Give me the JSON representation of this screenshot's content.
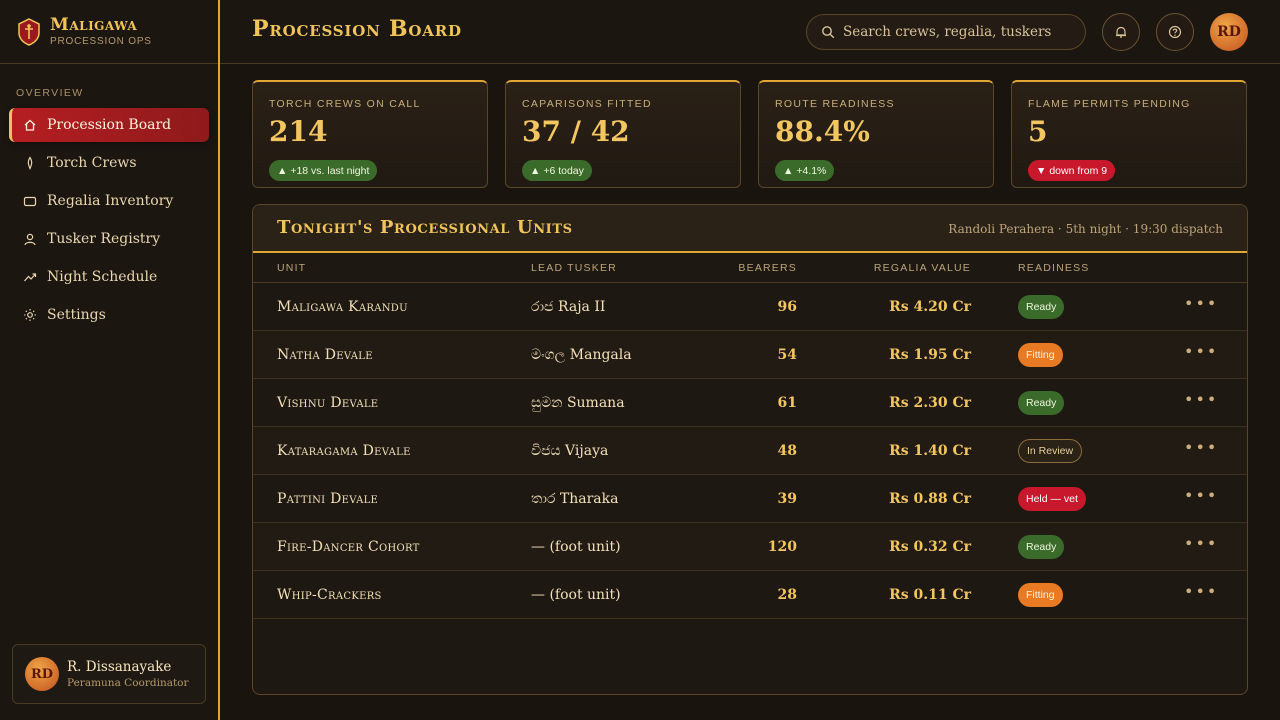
{
  "brand": {
    "name": "Maligawa",
    "subtitle": "PROCESSION OPS"
  },
  "sidebar": {
    "section": "OVERVIEW",
    "items": [
      {
        "label": "Procession Board",
        "icon": "home-icon",
        "active": true
      },
      {
        "label": "Torch Crews",
        "icon": "flame-icon"
      },
      {
        "label": "Regalia Inventory",
        "icon": "box-icon"
      },
      {
        "label": "Tusker Registry",
        "icon": "user-icon"
      },
      {
        "label": "Night Schedule",
        "icon": "trend-icon"
      },
      {
        "label": "Settings",
        "icon": "sun-gear-icon"
      }
    ],
    "user": {
      "initials": "RD",
      "name": "R. Dissanayake",
      "role": "Peramuna Coordinator"
    }
  },
  "header": {
    "title": "Procession Board",
    "search_placeholder": "Search crews, regalia, tuskers",
    "avatar_initials": "RD"
  },
  "stats": [
    {
      "label": "TORCH CREWS ON CALL",
      "value": "214",
      "delta": "+18 vs. last night",
      "trend": "up"
    },
    {
      "label": "CAPARISONS FITTED",
      "value": "37 / 42",
      "delta": "+6 today",
      "trend": "up"
    },
    {
      "label": "ROUTE READINESS",
      "value": "88.4%",
      "delta": "+4.1%",
      "trend": "up"
    },
    {
      "label": "FLAME PERMITS PENDING",
      "value": "5",
      "delta": "down from 9",
      "trend": "down"
    }
  ],
  "table": {
    "title": "Tonight's Processional Units",
    "meta": "Randoli Perahera · 5th night · 19:30 dispatch",
    "columns": [
      "UNIT",
      "LEAD TUSKER",
      "BEARERS",
      "REGALIA VALUE",
      "READINESS"
    ],
    "rows": [
      {
        "unit": "Maligawa Karandu",
        "tusker": "රාජ Raja II",
        "bearers": "96",
        "value": "Rs 4.20 Cr",
        "status": "Ready",
        "kind": "ready"
      },
      {
        "unit": "Natha Devale",
        "tusker": "මංගල Mangala",
        "bearers": "54",
        "value": "Rs 1.95 Cr",
        "status": "Fitting",
        "kind": "fitting"
      },
      {
        "unit": "Vishnu Devale",
        "tusker": "සුමන Sumana",
        "bearers": "61",
        "value": "Rs 2.30 Cr",
        "status": "Ready",
        "kind": "ready"
      },
      {
        "unit": "Kataragama Devale",
        "tusker": "විජය Vijaya",
        "bearers": "48",
        "value": "Rs 1.40 Cr",
        "status": "In Review",
        "kind": "review"
      },
      {
        "unit": "Pattini Devale",
        "tusker": "තාර Tharaka",
        "bearers": "39",
        "value": "Rs 0.88 Cr",
        "status": "Held — vet",
        "kind": "held"
      },
      {
        "unit": "Fire-Dancer Cohort",
        "tusker": "— (foot unit)",
        "bearers": "120",
        "value": "Rs 0.32 Cr",
        "status": "Ready",
        "kind": "ready"
      },
      {
        "unit": "Whip-Crackers",
        "tusker": "— (foot unit)",
        "bearers": "28",
        "value": "Rs 0.11 Cr",
        "status": "Fitting",
        "kind": "fitting"
      }
    ]
  },
  "colors": {
    "accent": "#e0a832",
    "crimson": "#b51e22",
    "ready": "#3b6b2a",
    "fitting": "#e87a24",
    "held": "#c8182c"
  }
}
